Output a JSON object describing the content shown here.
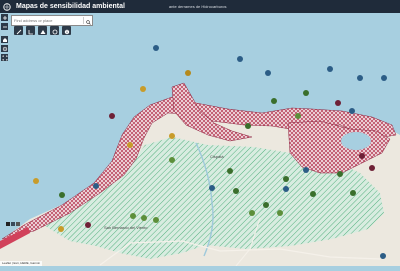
{
  "app": {
    "title": "Mapas de sensibilidad ambiental",
    "subtitle": "ante derrames de Hidrocarburos"
  },
  "search": {
    "placeholder": "Find address or place"
  },
  "places": [
    "San Bernardo del Viento",
    "Cispatá"
  ],
  "attribution": "Leaflet | Esri, HERE, Garmin",
  "colors": {
    "titlebar": "#1f2b3a",
    "water": "#a7cfe0",
    "land": "#ece8df",
    "sensitive_red": "#b3364f",
    "mangrove_green": "#4cae7a"
  }
}
